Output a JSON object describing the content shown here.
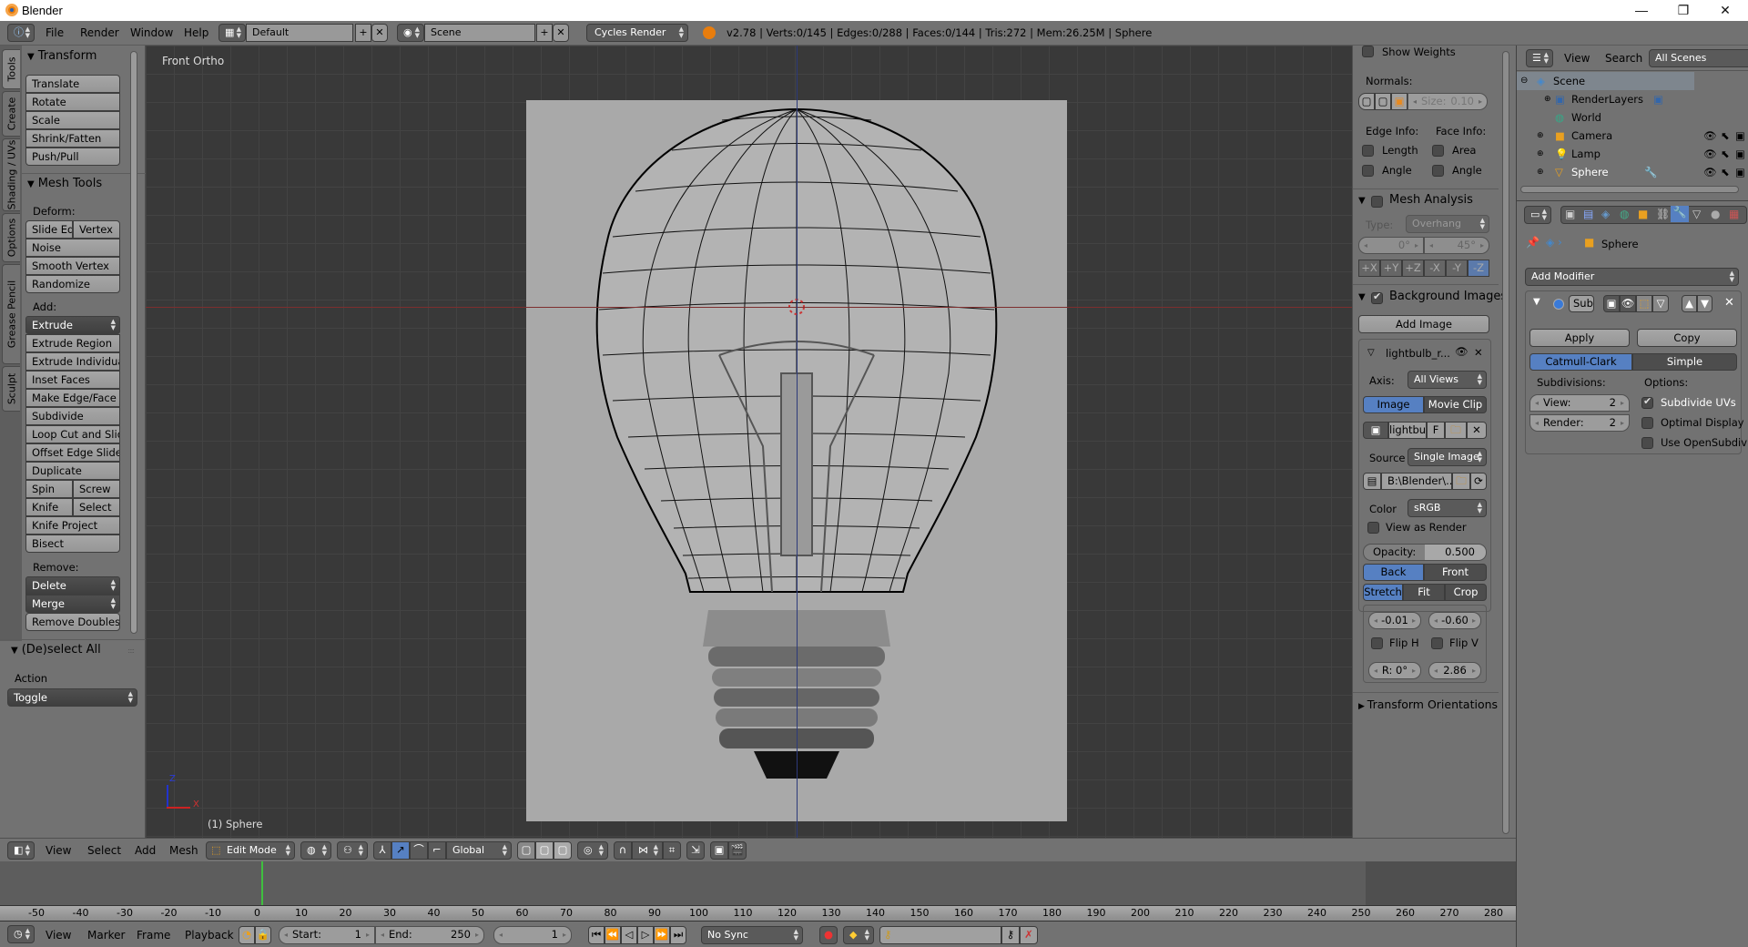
{
  "window": {
    "title": "Blender",
    "minimize": "—",
    "maximize": "❐",
    "close": "✕"
  },
  "info_header": {
    "menus": [
      "File",
      "Render",
      "Window",
      "Help"
    ],
    "screen_layout": "Default",
    "scene": "Scene",
    "render_engine": "Cycles Render",
    "stats": "v2.78 | Verts:0/145 | Edges:0/288 | Faces:0/144 | Tris:272 | Mem:26.25M | Sphere"
  },
  "tool_tabs": [
    "Tools",
    "Create",
    "Shading / UVs",
    "Options",
    "Grease Pencil",
    "Sculpt"
  ],
  "tool_shelf": {
    "transform": {
      "title": "Transform",
      "buttons": [
        "Translate",
        "Rotate",
        "Scale",
        "Shrink/Fatten",
        "Push/Pull"
      ]
    },
    "mesh_tools": {
      "title": "Mesh Tools",
      "deform_label": "Deform:",
      "deform_row": [
        "Slide Ed",
        "Vertex"
      ],
      "deform_buttons": [
        "Noise",
        "Smooth Vertex",
        "Randomize"
      ],
      "add_label": "Add:",
      "extrude_menu": "Extrude",
      "add_buttons": [
        "Extrude Region",
        "Extrude Individual",
        "Inset Faces",
        "Make Edge/Face",
        "Subdivide",
        "Loop Cut and Slide",
        "Offset Edge Slide",
        "Duplicate"
      ],
      "spin_row": [
        "Spin",
        "Screw"
      ],
      "knife_row": [
        "Knife",
        "Select"
      ],
      "more_buttons": [
        "Knife Project",
        "Bisect"
      ],
      "remove_label": "Remove:",
      "delete_menu": "Delete",
      "merge_menu": "Merge",
      "remove_doubles": "Remove Doubles"
    },
    "operator": {
      "title": "(De)select All",
      "action_label": "Action",
      "action_value": "Toggle"
    }
  },
  "viewport": {
    "view_name": "Front Ortho",
    "object_label": "(1) Sphere",
    "axis_z": "Z",
    "axis_x": "X"
  },
  "n_panel": {
    "show_weights": "Show Weights",
    "normals_label": "Normals:",
    "normals_size": {
      "label": "Size:",
      "value": "0.10"
    },
    "edge_info": "Edge Info:",
    "face_info": "Face Info:",
    "edge_length": "Length",
    "edge_angle": "Angle",
    "face_area": "Area",
    "face_angle": "Angle",
    "mesh_analysis": {
      "title": "Mesh Analysis",
      "type_label": "Type:",
      "type_value": "Overhang",
      "min": "0°",
      "max": "45°",
      "axes": [
        "+X",
        "+Y",
        "+Z",
        "-X",
        "-Y",
        "-Z"
      ],
      "selected_axis": "-Z"
    },
    "background_images": {
      "title": "Background Images",
      "enabled": true,
      "add_image": "Add Image",
      "image_name": "lightbulb_r...",
      "axis_label": "Axis:",
      "axis_value": "All Views",
      "source_tabs": [
        "Image",
        "Movie Clip"
      ],
      "image_field": "lightbu",
      "image_flag": "F",
      "source_label": "Source",
      "source_value": "Single Image",
      "filepath": "B:\\Blender\\...",
      "color_label": "Color",
      "color_value": "sRGB",
      "view_as_render": "View as Render",
      "opacity": {
        "label": "Opacity:",
        "value": "0.500"
      },
      "depth_tabs": [
        "Back",
        "Front"
      ],
      "fit_tabs": [
        "Stretch",
        "Fit",
        "Crop"
      ],
      "offset_x": "-0.01",
      "offset_y": "-0.60",
      "flip_h": "Flip H",
      "flip_v": "Flip V",
      "rotation": "R: 0°",
      "size": "2.86"
    },
    "transform_orientations": "Transform Orientations"
  },
  "outliner": {
    "menus": [
      "View",
      "Search"
    ],
    "filter": "All Scenes",
    "rows": [
      {
        "name": "Scene",
        "level": 0
      },
      {
        "name": "RenderLayers",
        "level": 1
      },
      {
        "name": "World",
        "level": 1
      },
      {
        "name": "Camera",
        "level": 1
      },
      {
        "name": "Lamp",
        "level": 1
      },
      {
        "name": "Sphere",
        "level": 1
      }
    ]
  },
  "properties": {
    "breadcrumb_object": "Sphere",
    "add_modifier": "Add Modifier",
    "modifier_name": "Sub",
    "apply": "Apply",
    "copy": "Copy",
    "subdiv_types": [
      "Catmull-Clark",
      "Simple"
    ],
    "selected_type": "Catmull-Clark",
    "subdivisions_label": "Subdivisions:",
    "options_label": "Options:",
    "view": {
      "label": "View:",
      "value": "2"
    },
    "render": {
      "label": "Render:",
      "value": "2"
    },
    "options": [
      {
        "label": "Subdivide UVs",
        "checked": true
      },
      {
        "label": "Optimal Display",
        "checked": false
      },
      {
        "label": "Use OpenSubdiv",
        "checked": false
      }
    ]
  },
  "view3d_header": {
    "menus": [
      "View",
      "Select",
      "Add",
      "Mesh"
    ],
    "mode": "Edit Mode",
    "orientation": "Global"
  },
  "timeline": {
    "ticks": [
      "-50",
      "-40",
      "-30",
      "-20",
      "-10",
      "0",
      "10",
      "20",
      "30",
      "40",
      "50",
      "60",
      "70",
      "80",
      "90",
      "100",
      "110",
      "120",
      "130",
      "140",
      "150",
      "160",
      "170",
      "180",
      "190",
      "200",
      "210",
      "220",
      "230",
      "240",
      "250",
      "260",
      "270",
      "280"
    ],
    "menus": [
      "View",
      "Marker",
      "Frame",
      "Playback"
    ],
    "start": {
      "label": "Start:",
      "value": "1"
    },
    "end": {
      "label": "End:",
      "value": "250"
    },
    "current_frame": "1",
    "sync": "No Sync"
  }
}
